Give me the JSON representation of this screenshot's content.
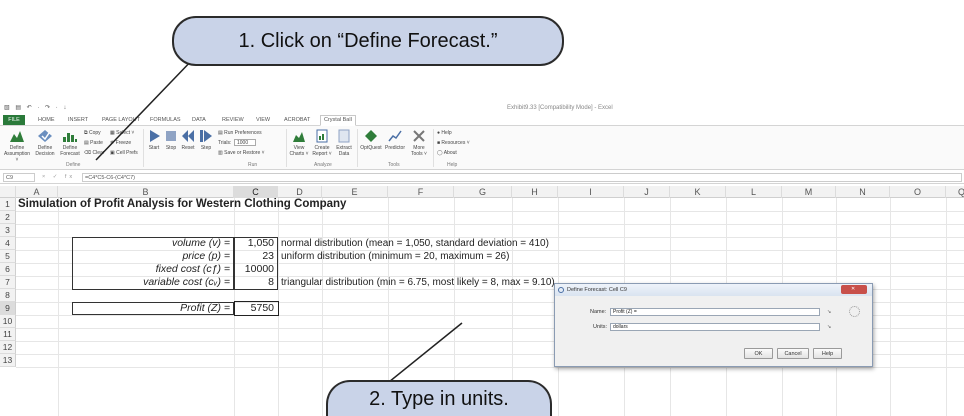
{
  "callouts": {
    "step1": "1. Click on “Define Forecast.”",
    "step2": "2. Type in units."
  },
  "window": {
    "quick_access": "▧ ▤ ↶ · ↷ · ↓",
    "title": "Exhibit9.33 [Compatibility Mode] - Excel"
  },
  "ribbon": {
    "tabs": [
      "FILE",
      "HOME",
      "INSERT",
      "PAGE LAYOUT",
      "FORMULAS",
      "DATA",
      "REVIEW",
      "VIEW",
      "ACROBAT",
      "Crystal Ball"
    ],
    "define": {
      "buttons": [
        "Define Assumption ˅",
        "Define Decision",
        "Define Forecast"
      ],
      "small": [
        "Copy",
        "Paste",
        "Clear",
        "Select ˅",
        "Freeze",
        "Cell Prefs"
      ],
      "group": "Define"
    },
    "run": {
      "buttons": [
        "Start",
        "Stop",
        "Reset",
        "Step"
      ],
      "small": [
        "Run Preferences",
        "Trials:",
        "Save or Restore ˅"
      ],
      "trials_value": "1000",
      "group": "Run"
    },
    "analyze": {
      "buttons": [
        "View Charts ˅",
        "Create Report ˅",
        "Extract Data"
      ],
      "group": "Analyze"
    },
    "tools": {
      "buttons": [
        "OptQuest",
        "Predictor",
        "More Tools ˅"
      ],
      "group": "Tools"
    },
    "help": {
      "small": [
        "Help",
        "Resources ˅",
        "About"
      ],
      "group": "Help"
    }
  },
  "formula_bar": {
    "name_box": "C9",
    "fx_icons": "× ✓ fx",
    "formula": "=C4*C5-C6-(C4*C7)"
  },
  "sheet": {
    "columns": [
      "A",
      "B",
      "C",
      "D",
      "E",
      "F",
      "G",
      "H",
      "I",
      "J",
      "K",
      "L",
      "M",
      "N",
      "O",
      "P",
      "Q"
    ],
    "rows": [
      "1",
      "2",
      "3",
      "4",
      "5",
      "6",
      "7",
      "8",
      "9",
      "10",
      "11",
      "12",
      "13"
    ],
    "title": "Simulation of Profit Analysis for Western Clothing Company",
    "labels": {
      "volume": "volume (v) =",
      "price": "price (p) =",
      "fixed": "fixed cost (cƒ) =",
      "variable": "variable cost (cᵥ) =",
      "profit": "Profit (Z) ="
    },
    "values": {
      "volume": "1,050",
      "price": "23",
      "fixed": "10000",
      "variable": "8",
      "profit": "5750"
    },
    "notes": {
      "volume": "normal distribution (mean = 1,050, standard deviation = 410)",
      "price": "uniform distribution (minimum = 20, maximum = 26)",
      "variable": "triangular distribution (min = 6.75, most likely = 8, max = 9.10)"
    }
  },
  "dialog": {
    "title": "Define Forecast: Cell C9",
    "name_label": "Name:",
    "name_value": "Profit (Z) =",
    "units_label": "Units:",
    "units_value": "dollars",
    "ok": "OK",
    "cancel": "Cancel",
    "help": "Help"
  }
}
